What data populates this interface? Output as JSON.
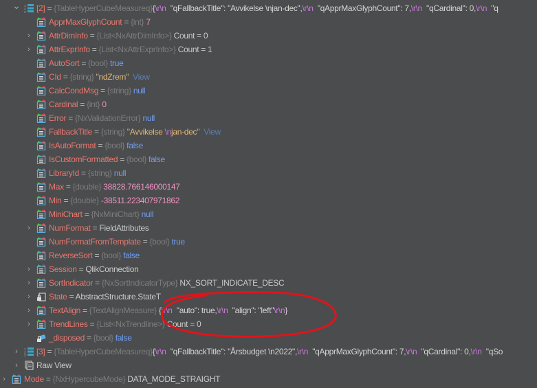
{
  "colors": {
    "key": "#e8776e",
    "type": "#7d7d7d",
    "bool": "#6e9ff5",
    "string": "#e0b77a",
    "escape": "#c678d8",
    "number": "#ee93c4",
    "background": "#4b4c4d",
    "annotation": "#e0141a"
  },
  "rows": [
    {
      "level": 0,
      "expandable": true,
      "expanded": true,
      "icon": "array-icon",
      "parts": [
        {
          "c": "k",
          "t": "[2]"
        },
        {
          "c": "eq",
          "t": " = "
        },
        {
          "c": "t",
          "t": "{TableHyperCubeMeasureq}"
        },
        {
          "c": "j",
          "t": "{"
        },
        {
          "c": "e",
          "t": "\\r\\n"
        },
        {
          "c": "j",
          "t": "  \"qFallbackTitle\": \"Avvikelse \\njan-dec\","
        },
        {
          "c": "e",
          "t": "\\r\\n"
        },
        {
          "c": "j",
          "t": "  \"qApprMaxGlyphCount\": 7,"
        },
        {
          "c": "e",
          "t": "\\r\\n"
        },
        {
          "c": "j",
          "t": "  \"qCardinal\": 0,"
        },
        {
          "c": "e",
          "t": "\\r\\n"
        },
        {
          "c": "j",
          "t": "  \"q"
        }
      ]
    },
    {
      "level": 1,
      "expandable": false,
      "icon": "property-icon",
      "parts": [
        {
          "c": "k",
          "t": "ApprMaxGlyphCount"
        },
        {
          "c": "eq",
          "t": " = "
        },
        {
          "c": "t",
          "t": "{int}"
        },
        {
          "c": "n",
          "t": " 7"
        }
      ]
    },
    {
      "level": 1,
      "expandable": true,
      "icon": "property-icon",
      "parts": [
        {
          "c": "k",
          "t": "AttrDimInfo"
        },
        {
          "c": "eq",
          "t": " = "
        },
        {
          "c": "t",
          "t": "{List<NxAttrDimInfo>}"
        },
        {
          "c": "v",
          "t": " Count = 0"
        }
      ]
    },
    {
      "level": 1,
      "expandable": true,
      "icon": "property-icon",
      "parts": [
        {
          "c": "k",
          "t": "AttrExprInfo"
        },
        {
          "c": "eq",
          "t": " = "
        },
        {
          "c": "t",
          "t": "{List<NxAttrExprInfo>}"
        },
        {
          "c": "v",
          "t": " Count = 1"
        }
      ]
    },
    {
      "level": 1,
      "expandable": false,
      "icon": "property-icon",
      "parts": [
        {
          "c": "k",
          "t": "AutoSort"
        },
        {
          "c": "eq",
          "t": " = "
        },
        {
          "c": "t",
          "t": "{bool}"
        },
        {
          "c": "b",
          "t": " true"
        }
      ]
    },
    {
      "level": 1,
      "expandable": false,
      "icon": "property-icon",
      "parts": [
        {
          "c": "k",
          "t": "CId"
        },
        {
          "c": "eq",
          "t": " = "
        },
        {
          "c": "t",
          "t": "{string}"
        },
        {
          "c": "s",
          "t": " \"ndZrem\""
        },
        {
          "c": "view",
          "t": "  View"
        }
      ]
    },
    {
      "level": 1,
      "expandable": false,
      "icon": "property-icon",
      "parts": [
        {
          "c": "k",
          "t": "CalcCondMsg"
        },
        {
          "c": "eq",
          "t": " = "
        },
        {
          "c": "t",
          "t": "{string}"
        },
        {
          "c": "b",
          "t": " null"
        }
      ]
    },
    {
      "level": 1,
      "expandable": false,
      "icon": "property-icon",
      "parts": [
        {
          "c": "k",
          "t": "Cardinal"
        },
        {
          "c": "eq",
          "t": " = "
        },
        {
          "c": "t",
          "t": "{int}"
        },
        {
          "c": "n",
          "t": " 0"
        }
      ]
    },
    {
      "level": 1,
      "expandable": false,
      "icon": "property-icon",
      "parts": [
        {
          "c": "k",
          "t": "Error"
        },
        {
          "c": "eq",
          "t": " = "
        },
        {
          "c": "t",
          "t": "{NxValidationError}"
        },
        {
          "c": "b",
          "t": " null"
        }
      ]
    },
    {
      "level": 1,
      "expandable": false,
      "icon": "property-icon",
      "parts": [
        {
          "c": "k",
          "t": "FallbackTitle"
        },
        {
          "c": "eq",
          "t": " = "
        },
        {
          "c": "t",
          "t": "{string}"
        },
        {
          "c": "s",
          "t": " \"Avvikelse "
        },
        {
          "c": "e",
          "t": "\\n"
        },
        {
          "c": "s",
          "t": "jan-dec\""
        },
        {
          "c": "view",
          "t": "  View"
        }
      ]
    },
    {
      "level": 1,
      "expandable": false,
      "icon": "property-icon",
      "parts": [
        {
          "c": "k",
          "t": "IsAutoFormat"
        },
        {
          "c": "eq",
          "t": " = "
        },
        {
          "c": "t",
          "t": "{bool}"
        },
        {
          "c": "b",
          "t": " false"
        }
      ]
    },
    {
      "level": 1,
      "expandable": false,
      "icon": "property-icon",
      "parts": [
        {
          "c": "k",
          "t": "IsCustomFormatted"
        },
        {
          "c": "eq",
          "t": " = "
        },
        {
          "c": "t",
          "t": "{bool}"
        },
        {
          "c": "b",
          "t": " false"
        }
      ]
    },
    {
      "level": 1,
      "expandable": false,
      "icon": "property-icon",
      "parts": [
        {
          "c": "k",
          "t": "LibraryId"
        },
        {
          "c": "eq",
          "t": " = "
        },
        {
          "c": "t",
          "t": "{string}"
        },
        {
          "c": "b",
          "t": " null"
        }
      ]
    },
    {
      "level": 1,
      "expandable": false,
      "icon": "property-icon",
      "parts": [
        {
          "c": "k",
          "t": "Max"
        },
        {
          "c": "eq",
          "t": " = "
        },
        {
          "c": "t",
          "t": "{double}"
        },
        {
          "c": "n",
          "t": " 38828.766146000147"
        }
      ]
    },
    {
      "level": 1,
      "expandable": false,
      "icon": "property-icon",
      "parts": [
        {
          "c": "k",
          "t": "Min"
        },
        {
          "c": "eq",
          "t": " = "
        },
        {
          "c": "t",
          "t": "{double}"
        },
        {
          "c": "n",
          "t": " -38511.223407971862"
        }
      ]
    },
    {
      "level": 1,
      "expandable": false,
      "icon": "property-icon",
      "parts": [
        {
          "c": "k",
          "t": "MiniChart"
        },
        {
          "c": "eq",
          "t": " = "
        },
        {
          "c": "t",
          "t": "{NxMiniChart}"
        },
        {
          "c": "b",
          "t": " null"
        }
      ]
    },
    {
      "level": 1,
      "expandable": true,
      "icon": "property-icon",
      "parts": [
        {
          "c": "k",
          "t": "NumFormat"
        },
        {
          "c": "eq",
          "t": " = "
        },
        {
          "c": "v",
          "t": "FieldAttributes"
        }
      ]
    },
    {
      "level": 1,
      "expandable": false,
      "icon": "property-icon",
      "parts": [
        {
          "c": "k",
          "t": "NumFormatFromTemplate"
        },
        {
          "c": "eq",
          "t": " = "
        },
        {
          "c": "t",
          "t": "{bool}"
        },
        {
          "c": "b",
          "t": " true"
        }
      ]
    },
    {
      "level": 1,
      "expandable": false,
      "icon": "property-icon",
      "parts": [
        {
          "c": "k",
          "t": "ReverseSort"
        },
        {
          "c": "eq",
          "t": " = "
        },
        {
          "c": "t",
          "t": "{bool}"
        },
        {
          "c": "b",
          "t": " false"
        }
      ]
    },
    {
      "level": 1,
      "expandable": true,
      "icon": "property-icon",
      "parts": [
        {
          "c": "k",
          "t": "Session"
        },
        {
          "c": "eq",
          "t": " = "
        },
        {
          "c": "v",
          "t": "QlikConnection"
        }
      ]
    },
    {
      "level": 1,
      "expandable": true,
      "icon": "property-icon",
      "parts": [
        {
          "c": "k",
          "t": "SortIndicator"
        },
        {
          "c": "eq",
          "t": " = "
        },
        {
          "c": "t",
          "t": "{NxSortIndicatorType}"
        },
        {
          "c": "v",
          "t": " NX_SORT_INDICATE_DESC"
        }
      ]
    },
    {
      "level": 1,
      "expandable": true,
      "icon": "locked-property-icon",
      "parts": [
        {
          "c": "k",
          "t": "State"
        },
        {
          "c": "eq",
          "t": " = "
        },
        {
          "c": "v",
          "t": "AbstractStructure.StateT"
        }
      ]
    },
    {
      "level": 1,
      "expandable": true,
      "icon": "property-icon",
      "parts": [
        {
          "c": "k",
          "t": "TextAlign"
        },
        {
          "c": "eq",
          "t": " = "
        },
        {
          "c": "t",
          "t": "{TextAlignMeasure}"
        },
        {
          "c": "j",
          "t": " {"
        },
        {
          "c": "e",
          "t": "\\r\\n"
        },
        {
          "c": "j",
          "t": "  \"auto\": true,"
        },
        {
          "c": "e",
          "t": "\\r\\n"
        },
        {
          "c": "j",
          "t": "  \"align\": \"left\""
        },
        {
          "c": "e",
          "t": "\\r\\n"
        },
        {
          "c": "j",
          "t": "}"
        }
      ]
    },
    {
      "level": 1,
      "expandable": true,
      "icon": "property-icon",
      "parts": [
        {
          "c": "k",
          "t": "TrendLines"
        },
        {
          "c": "eq",
          "t": " = "
        },
        {
          "c": "t",
          "t": "{List<NxTrendline>}"
        },
        {
          "c": "v",
          "t": " Count = 0"
        }
      ]
    },
    {
      "level": 1,
      "expandable": false,
      "icon": "private-field-icon",
      "parts": [
        {
          "c": "k",
          "t": "_disposed"
        },
        {
          "c": "eq",
          "t": " = "
        },
        {
          "c": "t",
          "t": "{bool}"
        },
        {
          "c": "b",
          "t": " false"
        }
      ]
    },
    {
      "level": 0,
      "expandable": true,
      "icon": "array-icon",
      "parts": [
        {
          "c": "k",
          "t": "[3]"
        },
        {
          "c": "eq",
          "t": " = "
        },
        {
          "c": "t",
          "t": "{TableHyperCubeMeasureq}"
        },
        {
          "c": "j",
          "t": "{"
        },
        {
          "c": "e",
          "t": "\\r\\n"
        },
        {
          "c": "j",
          "t": "  \"qFallbackTitle\": \"Årsbudget \\n2022\","
        },
        {
          "c": "e",
          "t": "\\r\\n"
        },
        {
          "c": "j",
          "t": "  \"qApprMaxGlyphCount\": 7,"
        },
        {
          "c": "e",
          "t": "\\r\\n"
        },
        {
          "c": "j",
          "t": "  \"qCardinal\": 0,"
        },
        {
          "c": "e",
          "t": "\\r\\n"
        },
        {
          "c": "j",
          "t": "  \"qSo"
        }
      ]
    },
    {
      "level": 0,
      "expandable": true,
      "icon": "raw-view-icon",
      "parts": [
        {
          "c": "plain",
          "t": "Raw View"
        }
      ]
    },
    {
      "level": -1,
      "expandable": true,
      "icon": "property-icon",
      "parts": [
        {
          "c": "k",
          "t": "Mode"
        },
        {
          "c": "eq",
          "t": " = "
        },
        {
          "c": "t",
          "t": "{NxHypercubeMode}"
        },
        {
          "c": "v",
          "t": " DATA_MODE_STRAIGHT"
        }
      ]
    }
  ]
}
